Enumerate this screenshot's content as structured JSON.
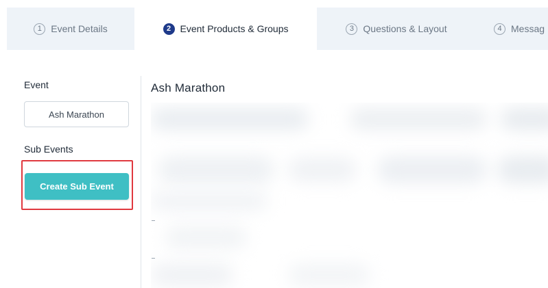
{
  "tabs": [
    {
      "number": "1",
      "label": "Event Details",
      "active": false
    },
    {
      "number": "2",
      "label": "Event Products & Groups",
      "active": true
    },
    {
      "number": "3",
      "label": "Questions & Layout",
      "active": false
    },
    {
      "number": "4",
      "label": "Messag",
      "active": false
    }
  ],
  "sidebar": {
    "event_label": "Event",
    "event_value": "Ash Marathon",
    "sub_events_label": "Sub Events",
    "create_button_label": "Create Sub Event"
  },
  "main": {
    "title": "Ash Marathon"
  },
  "colors": {
    "active_tab_number_bg": "#1e3a8a",
    "button_bg": "#3fbfc4",
    "highlight_border": "#e0383e",
    "inactive_tab_bg": "#eef3f8"
  }
}
